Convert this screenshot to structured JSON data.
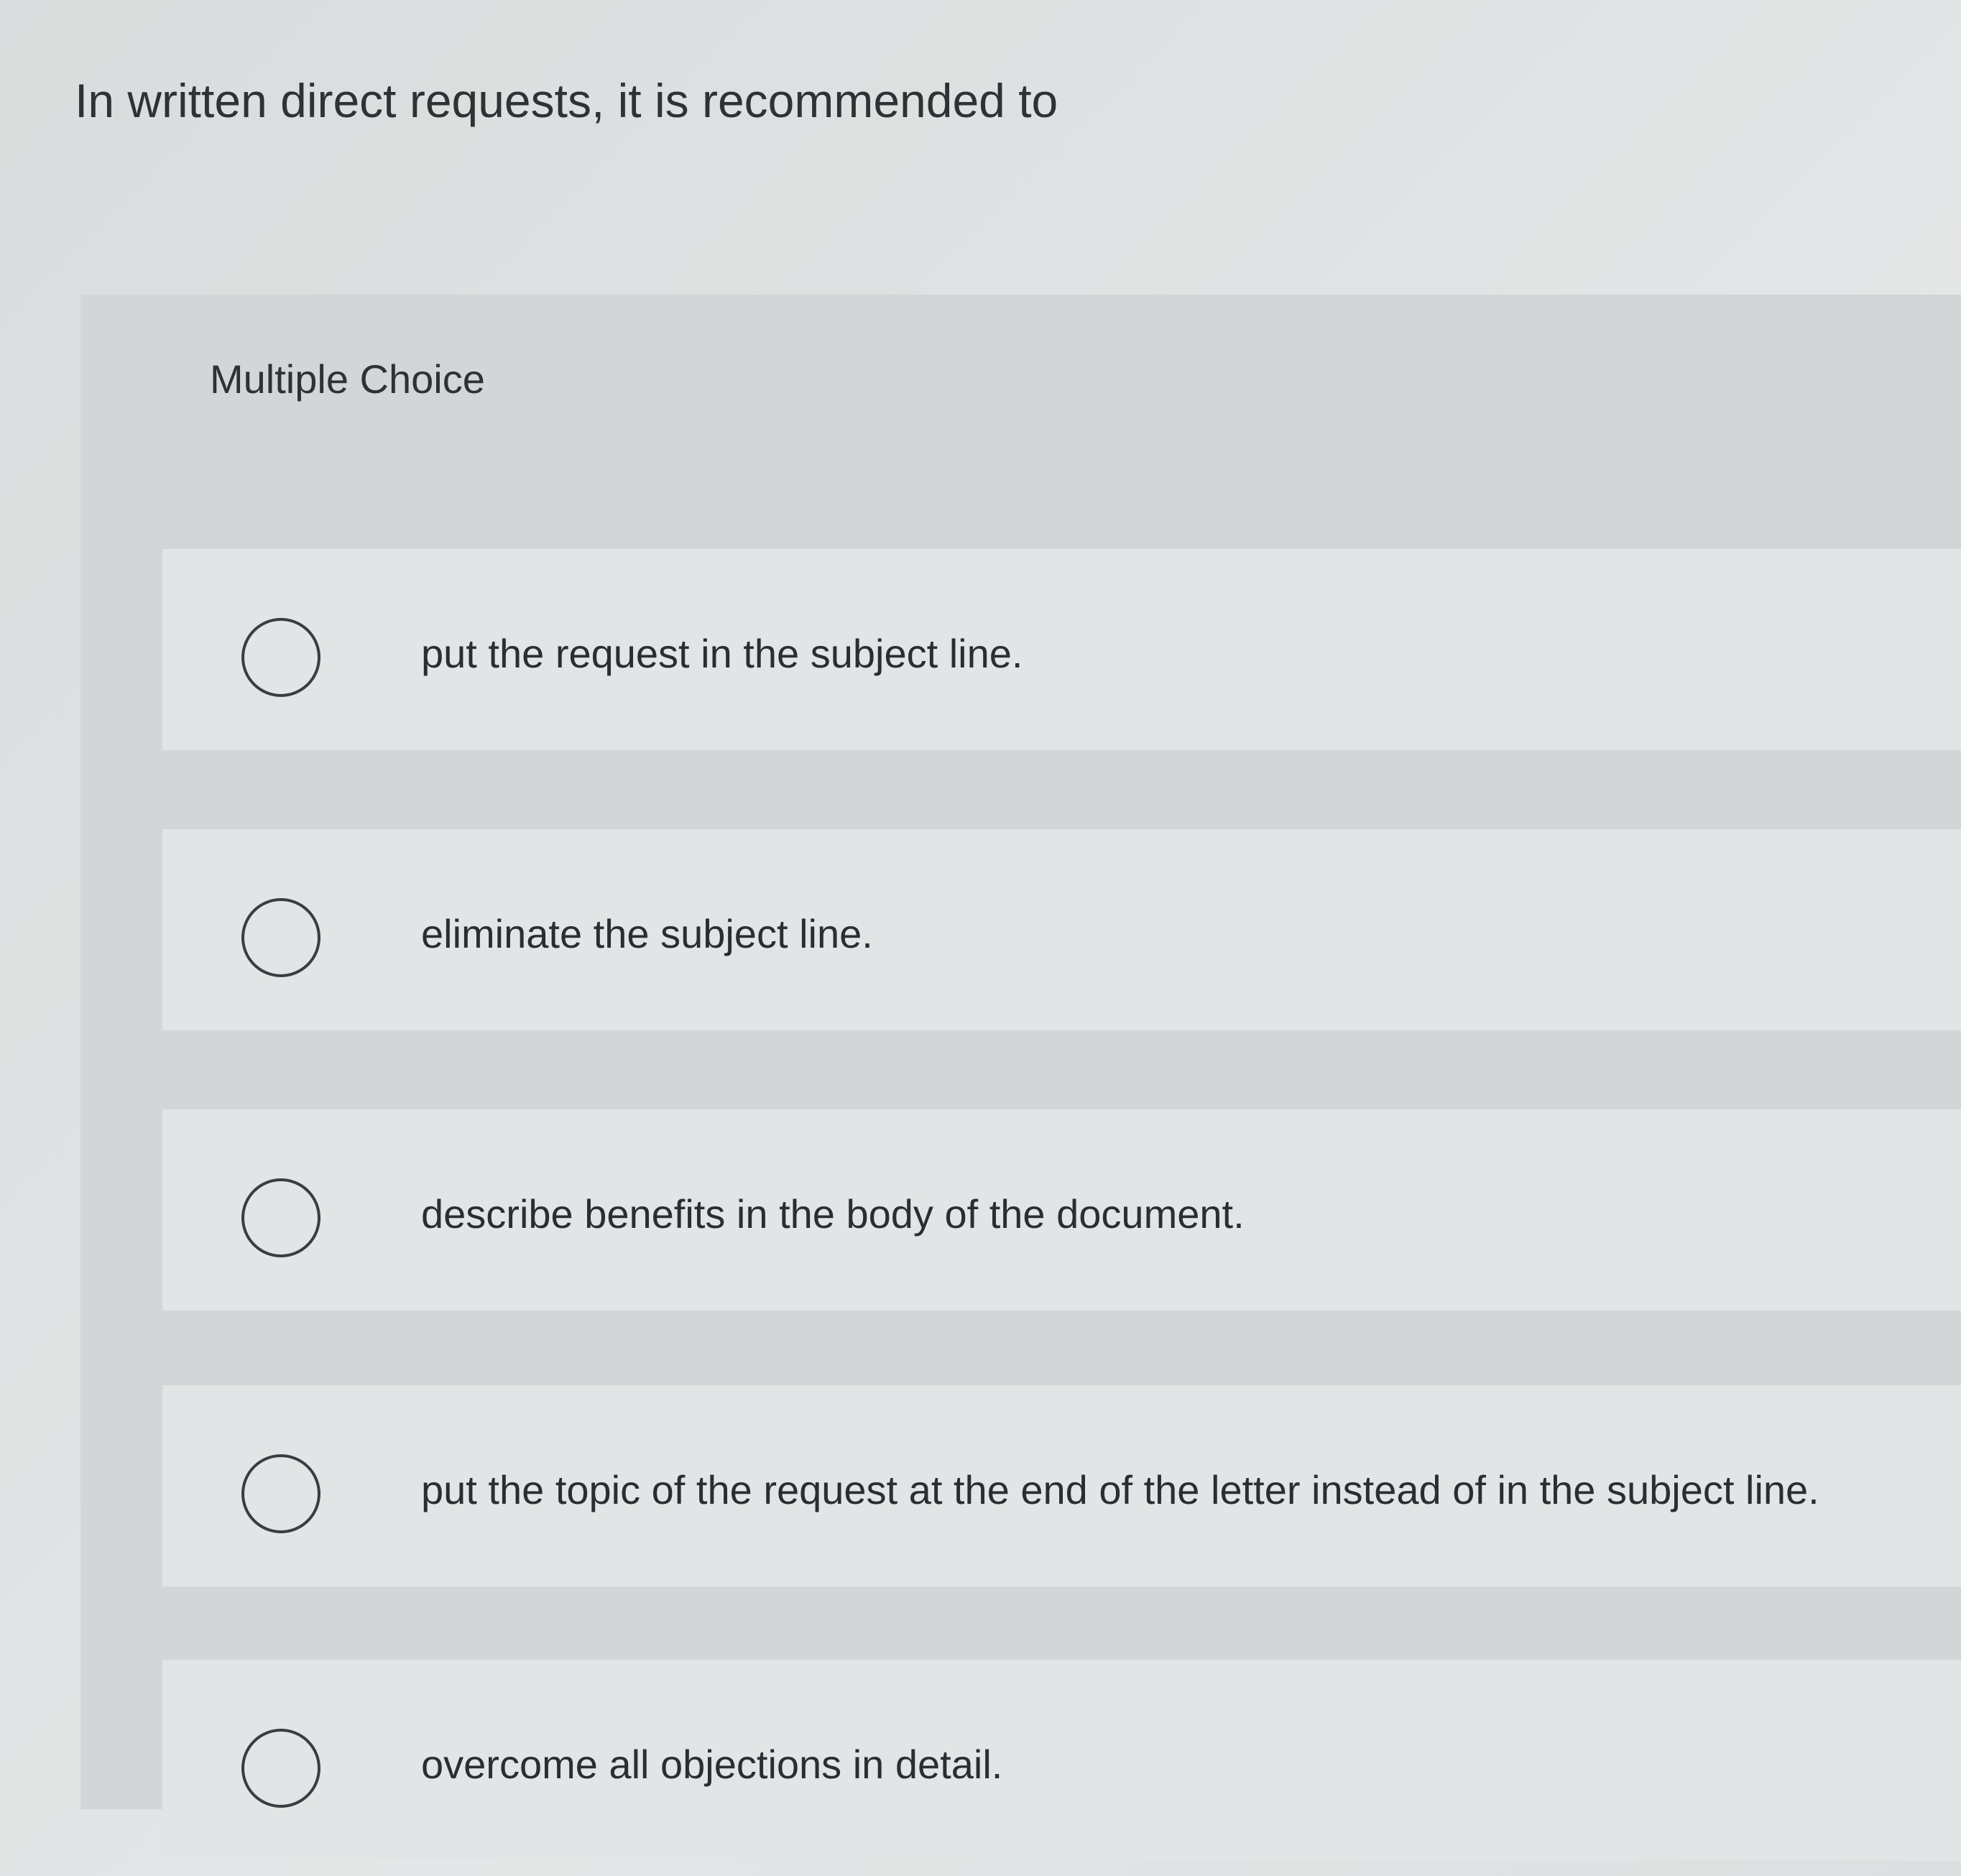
{
  "question": {
    "text": "In written direct requests, it is recommended to"
  },
  "panel": {
    "label": "Multiple Choice"
  },
  "choices": [
    {
      "label": "put the request in the subject line.",
      "selected": false
    },
    {
      "label": "eliminate the subject line.",
      "selected": false
    },
    {
      "label": "describe benefits in the body of the document.",
      "selected": false
    },
    {
      "label": "put the topic of the request at the end of the letter instead of in the subject line.",
      "selected": false
    },
    {
      "label": "overcome all objections in detail.",
      "selected": false
    }
  ],
  "colors": {
    "background": "#dfe2e2",
    "panel": "#d3d6d7",
    "choice_row": "#e2e5e5",
    "text": "#2b2d30"
  }
}
